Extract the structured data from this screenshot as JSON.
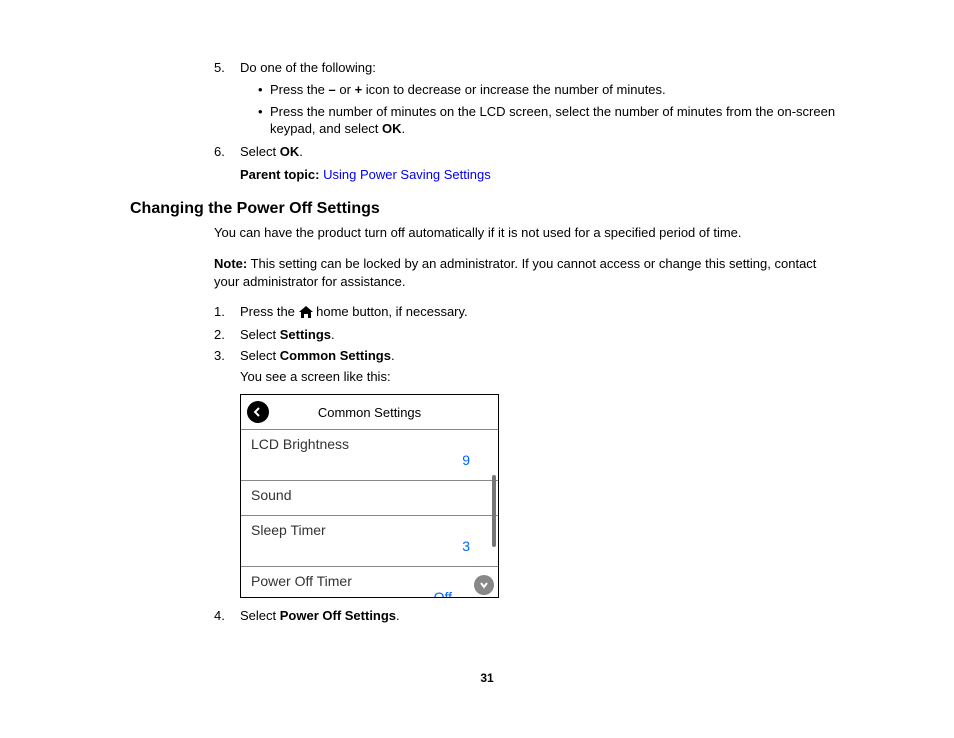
{
  "step5": {
    "num": "5.",
    "text": "Do one of the following:",
    "bullet1_pre": "Press the ",
    "bullet1_minus": "–",
    "bullet1_mid": " or ",
    "bullet1_plus": "+",
    "bullet1_post": " icon to decrease or increase the number of minutes.",
    "bullet2_pre": "Press the number of minutes on the LCD screen, select the number of minutes from the on-screen keypad, and select ",
    "bullet2_bold": "OK",
    "bullet2_post": "."
  },
  "step6": {
    "num": "6.",
    "pre": "Select ",
    "bold": "OK",
    "post": "."
  },
  "parent": {
    "label": "Parent topic:",
    "link": "Using Power Saving Settings"
  },
  "heading": "Changing the Power Off Settings",
  "intro": "You can have the product turn off automatically if it is not used for a specified period of time.",
  "note": {
    "label": "Note:",
    "text": " This setting can be locked by an administrator. If you cannot access or change this setting, contact your administrator for assistance."
  },
  "s1": {
    "num": "1.",
    "pre": "Press the ",
    "post": " home button, if necessary."
  },
  "s2": {
    "num": "2.",
    "pre": "Select ",
    "bold": "Settings",
    "post": "."
  },
  "s3": {
    "num": "3.",
    "pre": "Select ",
    "bold": "Common Settings",
    "post": ".",
    "sub": "You see a screen like this:"
  },
  "s4": {
    "num": "4.",
    "pre": "Select ",
    "bold": "Power Off Settings",
    "post": "."
  },
  "screen": {
    "title": "Common Settings",
    "rows": {
      "lcd": {
        "label": "LCD Brightness",
        "value": "9"
      },
      "sound": {
        "label": "Sound"
      },
      "sleep": {
        "label": "Sleep Timer",
        "value": "3"
      },
      "poweroff": {
        "label": "Power Off Timer",
        "value": "Off"
      }
    }
  },
  "pageNumber": "31"
}
